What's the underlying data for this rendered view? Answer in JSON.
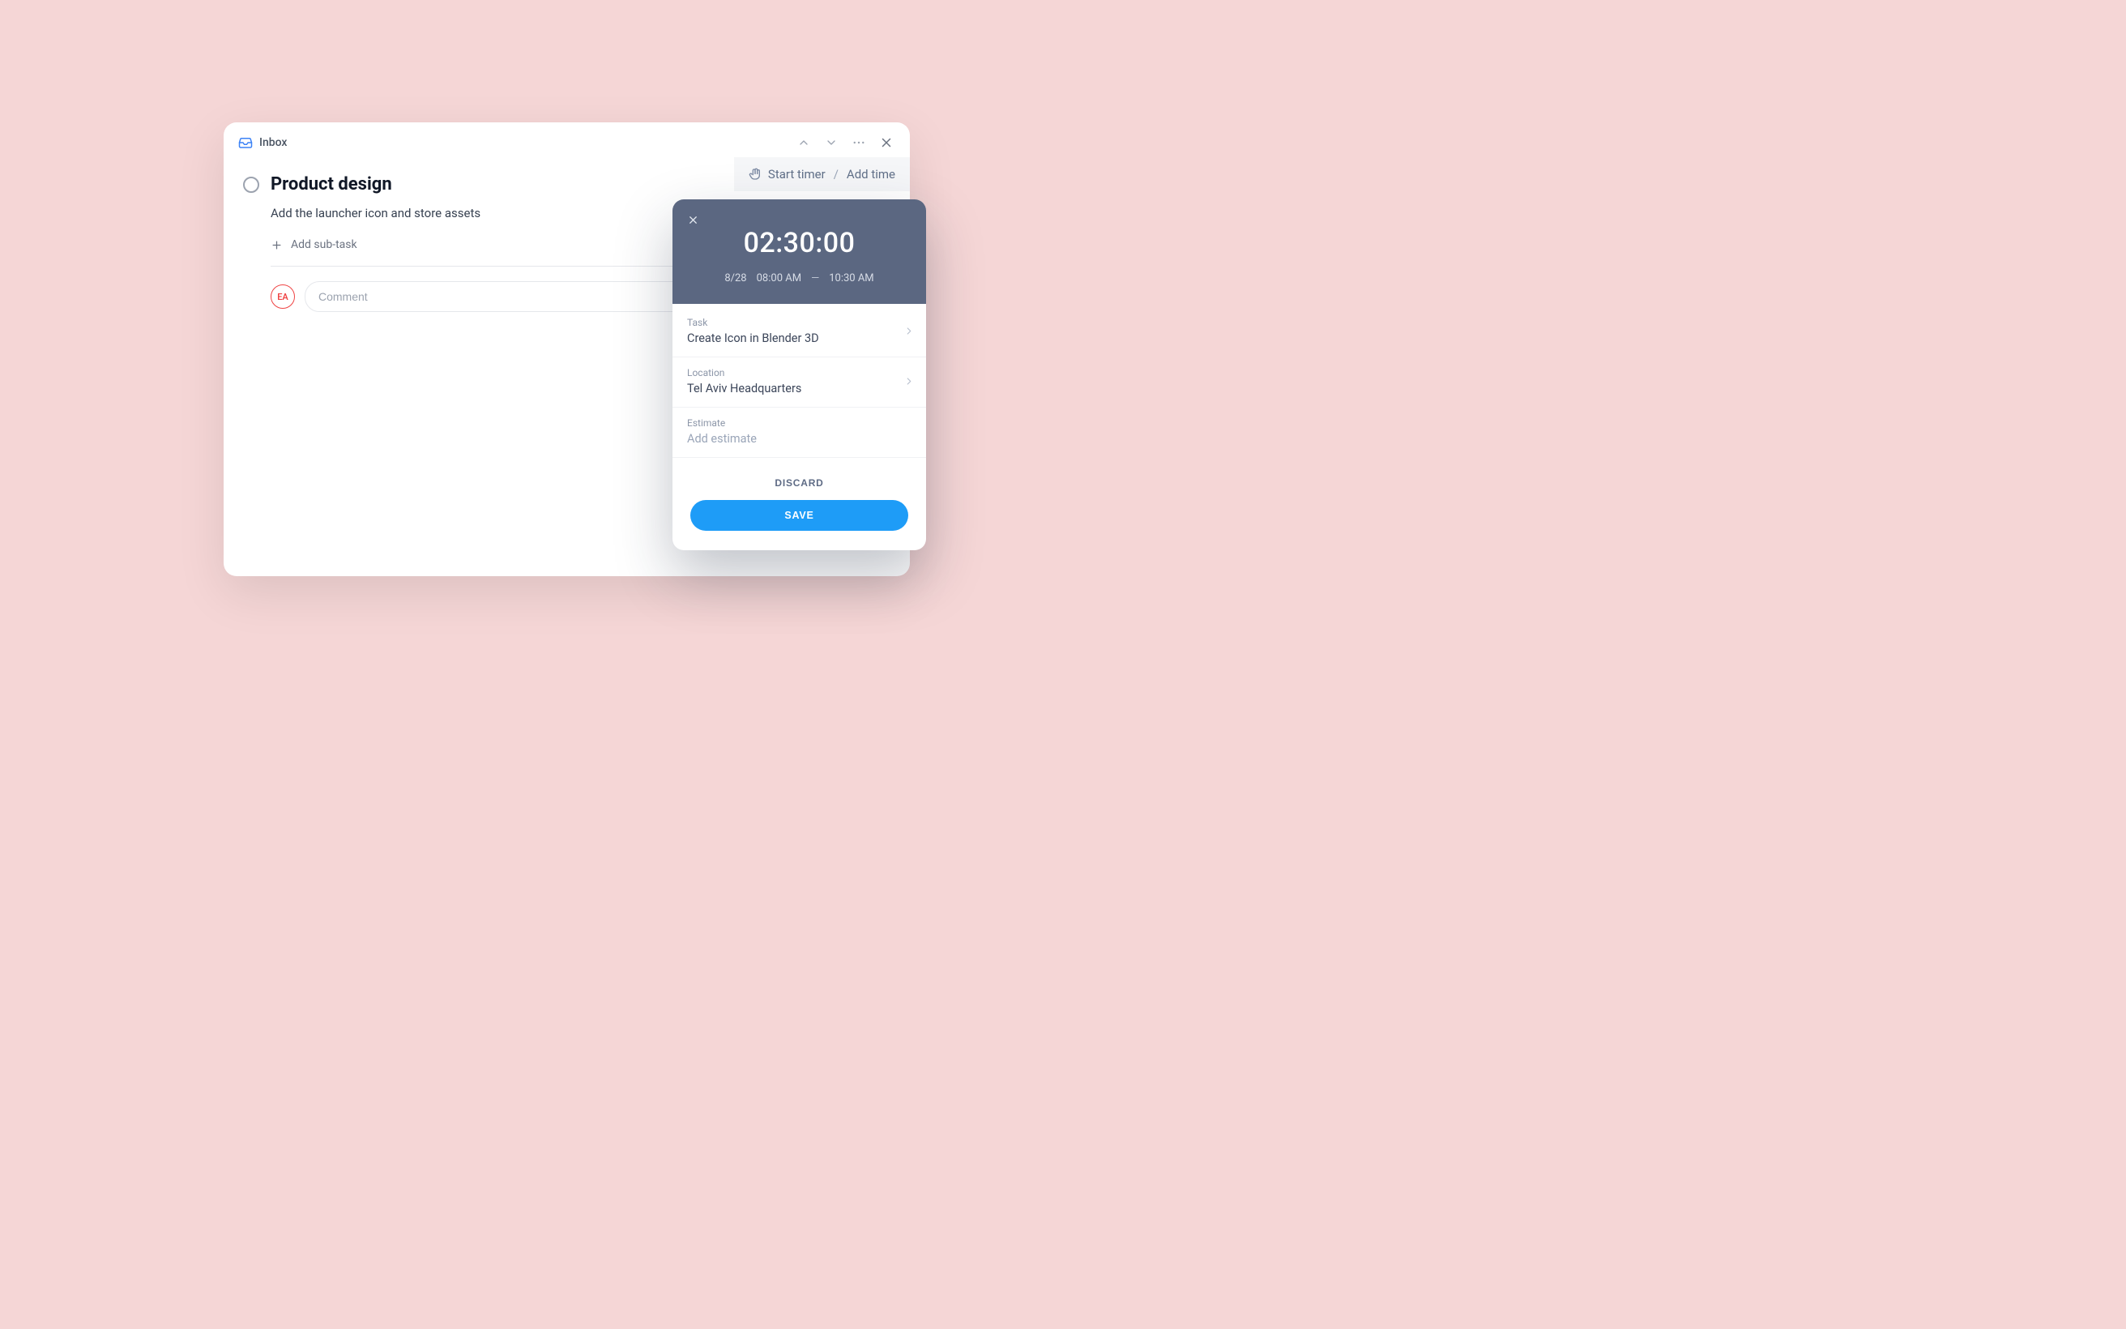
{
  "header": {
    "inbox_label": "Inbox"
  },
  "task": {
    "title": "Product design",
    "description": "Add the launcher icon and store assets",
    "add_subtask_label": "Add sub-task",
    "avatar_initials": "EA",
    "comment_placeholder": "Comment"
  },
  "timer_bar": {
    "start_timer": "Start timer",
    "separator": "/",
    "add_time": "Add time"
  },
  "panel": {
    "duration": "02:30:00",
    "date": "8/28",
    "start_time": "08:00 AM",
    "end_time": "10:30 AM",
    "fields": {
      "task": {
        "label": "Task",
        "value": "Create Icon in Blender 3D"
      },
      "location": {
        "label": "Location",
        "value": "Tel Aviv Headquarters"
      },
      "estimate": {
        "label": "Estimate",
        "placeholder": "Add estimate"
      }
    },
    "actions": {
      "discard": "DISCARD",
      "save": "SAVE"
    }
  }
}
